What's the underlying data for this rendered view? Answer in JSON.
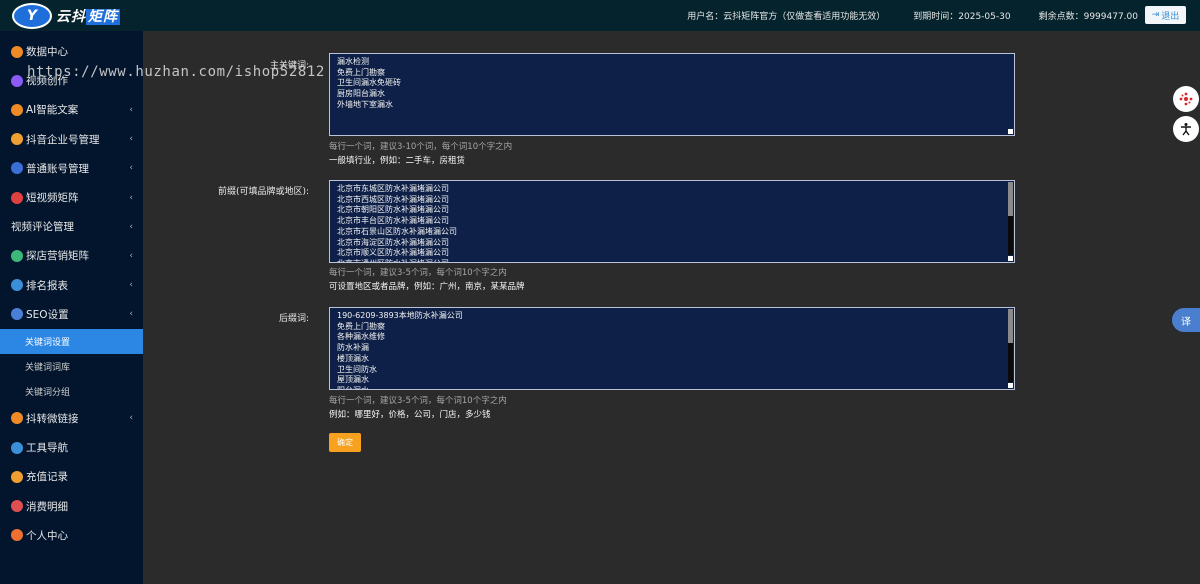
{
  "header": {
    "logo_badge": "Y",
    "logo_text_1": "云抖",
    "logo_text_2": "矩阵",
    "username": "用户名：云抖矩阵官方（仅做查看适用功能无效）",
    "expire": "到期时间：2025-05-30",
    "points": "剩余点数：9999477.00",
    "logout": "退出"
  },
  "watermark": "https://www.huzhan.com/ishop52812",
  "sidebar": {
    "items": [
      {
        "label": "数据中心",
        "icon": "data-center-icon",
        "color": "#f08a24",
        "chevron": false
      },
      {
        "label": "视频创作",
        "icon": "video-create-icon",
        "color": "#8a5cf5",
        "chevron": false
      },
      {
        "label": "AI智能文案",
        "icon": "ai-icon",
        "color": "#f08a24",
        "chevron": true
      },
      {
        "label": "抖音企业号管理",
        "icon": "enterprise-icon",
        "color": "#f0a030",
        "chevron": true
      },
      {
        "label": "普通账号管理",
        "icon": "account-icon",
        "color": "#3b6fd8",
        "chevron": true
      },
      {
        "label": "短视频矩阵",
        "icon": "short-video-icon",
        "color": "#e04040",
        "chevron": true
      },
      {
        "label": "视频评论管理",
        "icon": "",
        "color": "",
        "chevron": true
      },
      {
        "label": "探店营销矩阵",
        "icon": "store-icon",
        "color": "#3cb878",
        "chevron": true
      },
      {
        "label": "排名报表",
        "icon": "ranking-icon",
        "color": "#3b8fd8",
        "chevron": true
      },
      {
        "label": "SEO设置",
        "icon": "seo-icon",
        "color": "#4a7fd8",
        "chevron": true
      }
    ],
    "sub_items": [
      {
        "label": "关键词设置",
        "active": true
      },
      {
        "label": "关键词词库",
        "active": false
      },
      {
        "label": "关键词分组",
        "active": false
      }
    ],
    "items_after": [
      {
        "label": "抖转微链接",
        "icon": "link-icon",
        "color": "#f08a24",
        "chevron": true
      },
      {
        "label": "工具导航",
        "icon": "tool-icon",
        "color": "#3b8fd8",
        "chevron": false
      },
      {
        "label": "充值记录",
        "icon": "recharge-icon",
        "color": "#f0a030",
        "chevron": false
      },
      {
        "label": "消费明细",
        "icon": "consume-icon",
        "color": "#e05050",
        "chevron": false
      },
      {
        "label": "个人中心",
        "icon": "user-center-icon",
        "color": "#f07030",
        "chevron": false
      }
    ]
  },
  "form": {
    "main_keyword": {
      "label": "主关键词:",
      "lines": [
        "漏水检测",
        "免费上门勘察",
        "卫生间漏水免砸砖",
        "厨房阳台漏水",
        "外墙地下室漏水"
      ],
      "hint": "每行一个词，建议3-10个词，每个词10个字之内",
      "example": "一般填行业，例如：二手车，房租赁"
    },
    "prefix": {
      "label": "前缀(可填品牌或地区):",
      "lines": [
        "北京市东城区防水补漏堵漏公司",
        "北京市西城区防水补漏堵漏公司",
        "北京市朝阳区防水补漏堵漏公司",
        "北京市丰台区防水补漏堵漏公司",
        "北京市石景山区防水补漏堵漏公司",
        "北京市海淀区防水补漏堵漏公司",
        "北京市顺义区防水补漏堵漏公司",
        "北京市通州区防水补漏堵漏公司"
      ],
      "hint": "每行一个词，建议3-5个词，每个词10个字之内",
      "example": "可设置地区或者品牌，例如：广州，南京，某某品牌"
    },
    "suffix": {
      "label": "后缀词:",
      "lines": [
        "190-6209-3893本地防水补漏公司",
        "免费上门勘察",
        "各种漏水维修",
        "防水补漏",
        "楼顶漏水",
        "卫生间防水",
        "屋顶漏水",
        "阳台漏水"
      ],
      "hint": "每行一个词，建议3-5个词，每个词10个字之内",
      "example": "例如：哪里好，价格，公司，门店，多少钱"
    },
    "confirm": "确定"
  },
  "floating": {
    "translate_label": "译"
  }
}
